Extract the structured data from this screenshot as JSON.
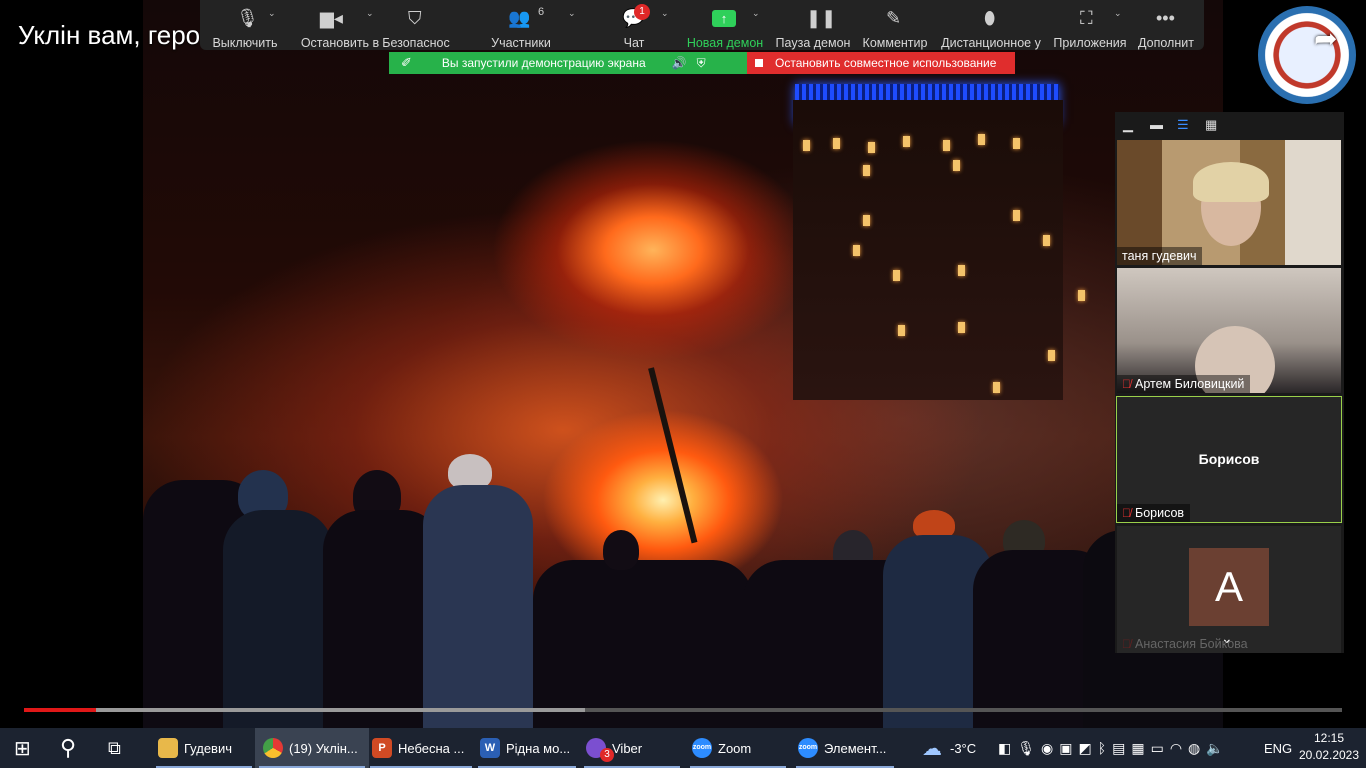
{
  "video": {
    "title": "Уклін вам, геро"
  },
  "toolbar": {
    "mute": "Выключить",
    "video": "Остановить в",
    "security": "Безопаснос",
    "participants": "Участники",
    "participants_count": "6",
    "chat": "Чат",
    "chat_badge": "1",
    "new_share": "Новая демон",
    "pause_share": "Пауза демон",
    "annotate": "Комментир",
    "remote": "Дистанционное у",
    "apps": "Приложения",
    "more": "Дополнит"
  },
  "share": {
    "status": "Вы запустили демонстрацию экрана",
    "stop": "Остановить совместное использование"
  },
  "gallery": {
    "tiles": [
      {
        "name": "таня гудевич"
      },
      {
        "name": "Артем Биловицкий"
      },
      {
        "name": "Борисов",
        "label": "Борисов"
      },
      {
        "name": "Анастасия Бойкова",
        "initial": "A"
      }
    ]
  },
  "playback": {
    "played_fraction": 0.055,
    "buffered_fraction": 0.426
  },
  "taskbar": {
    "items": [
      {
        "label": "Гудевич"
      },
      {
        "label": "(19) Уклін..."
      },
      {
        "label": "Небесна ..."
      },
      {
        "label": "Рідна мо..."
      },
      {
        "label": "Viber",
        "badge": "3"
      },
      {
        "label": "Zoom"
      },
      {
        "label": "Элемент..."
      }
    ],
    "weather": "-3°C",
    "language": "ENG",
    "time": "12:15",
    "date": "20.02.2023"
  },
  "colors": {
    "share_green": "#27b24a",
    "stop_red": "#e02d2d",
    "taskbar": "#1c2330",
    "toolbar": "#232323"
  }
}
